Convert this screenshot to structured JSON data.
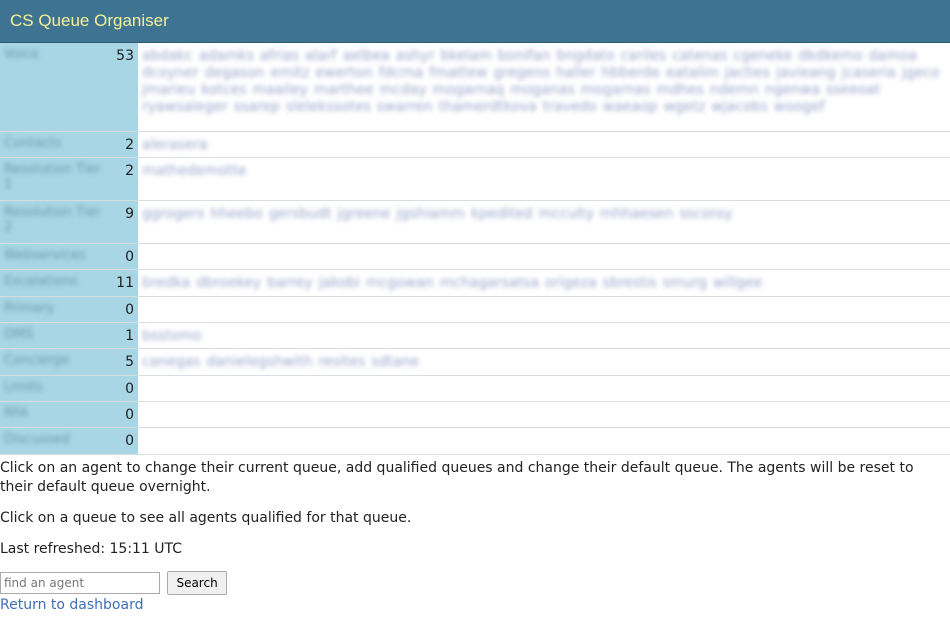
{
  "header": {
    "title": "CS Queue Organiser"
  },
  "queues": [
    {
      "name": "Voice",
      "count": "53",
      "height": 88,
      "agents": [
        "abdakc",
        "adamks",
        "afrias",
        "alarf",
        "aelbea",
        "ashyr",
        "bkelam",
        "bonifan",
        "bngdato",
        "cariles",
        "catenas",
        "cgeneke",
        "dkdkemo",
        "damoa",
        "dcoyner",
        "degason",
        "emitz",
        "ewerton",
        "fdcrna",
        "fmattew",
        "gregens",
        "haller",
        "hbberde",
        "eatalim",
        "jacties",
        "javieang",
        "jcaseria",
        "jgeco",
        "jmarieu",
        "kotces",
        "maailey",
        "marthee",
        "mcday",
        "mogarnaq",
        "moganas",
        "mogarnas",
        "mdhes",
        "ndemn",
        "ngenwa",
        "sseeoat",
        "ryawsaleger",
        "ssarep",
        "slelekssotes",
        "swarren",
        "thamerdtkova",
        "travedo",
        "waeaop",
        "wgetz",
        "wjacobs",
        "woogef"
      ]
    },
    {
      "name": "Contacts",
      "count": "2",
      "height": 26,
      "agents": [
        "alerasera"
      ]
    },
    {
      "name": "Resolution Tier 1",
      "count": "2",
      "height": 43,
      "agents": [
        "mathedemotte"
      ]
    },
    {
      "name": "Resolution Tier 2",
      "count": "9",
      "height": 43,
      "agents": [
        "ggrogers",
        "hheebo",
        "gersbudt",
        "jgreene",
        "jgshiamm",
        "kpedited",
        "mcculty",
        "mhhaesen",
        "sscoroy"
      ]
    },
    {
      "name": "Webservices",
      "count": "0",
      "height": 26,
      "agents": []
    },
    {
      "name": "Escalations",
      "count": "11",
      "height": 27,
      "agents": [
        "bredka",
        "dbroekey",
        "barrey",
        "jakobi",
        "mcgowan",
        "mchagarsatsa",
        "origeza",
        "sbrestis",
        "smurg",
        "willgee"
      ]
    },
    {
      "name": "Primary",
      "count": "0",
      "height": 26,
      "agents": []
    },
    {
      "name": "DMS",
      "count": "1",
      "height": 26,
      "agents": [
        "bsstomo"
      ]
    },
    {
      "name": "Concierge",
      "count": "5",
      "height": 27,
      "agents": [
        "canegas",
        "danielegshwith",
        "resites",
        "sdtane"
      ]
    },
    {
      "name": "Limits",
      "count": "0",
      "height": 26,
      "agents": []
    },
    {
      "name": "RFA",
      "count": "0",
      "height": 26,
      "agents": []
    },
    {
      "name": "Discussed",
      "count": "0",
      "height": 27,
      "agents": []
    }
  ],
  "info": {
    "line1": "Click on an agent to change their current queue, add qualified queues and change their default queue. The agents will be reset to their default queue overnight.",
    "line2": "Click on a queue to see all agents qualified for that queue.",
    "refreshed": "Last refreshed: 15:11 UTC"
  },
  "search": {
    "placeholder": "find an agent",
    "button": "Search"
  },
  "links": {
    "dashboard": "Return to dashboard"
  }
}
